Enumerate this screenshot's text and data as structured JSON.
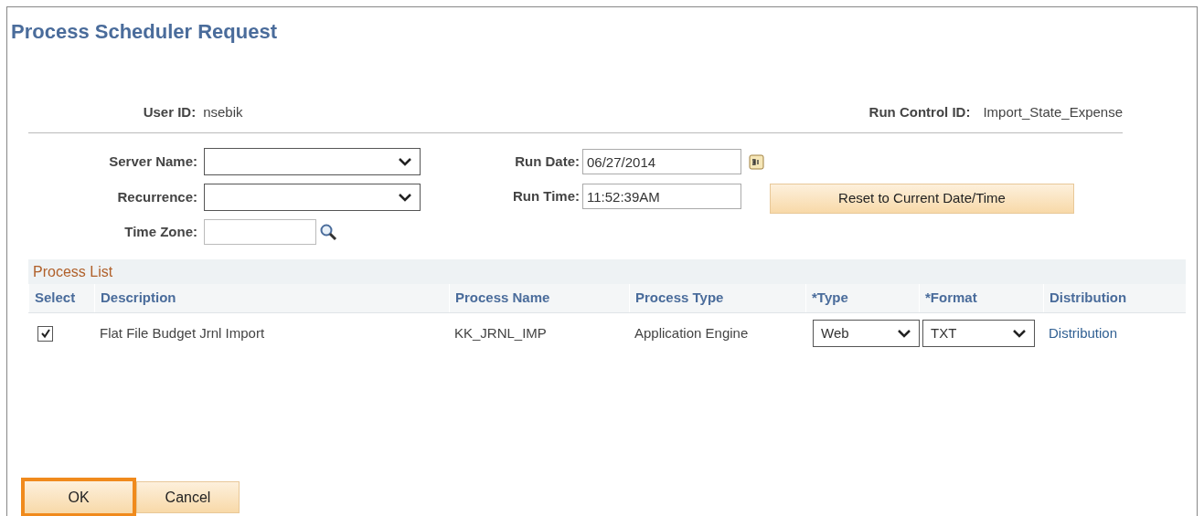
{
  "title": "Process Scheduler Request",
  "user_id": {
    "label": "User ID:",
    "value": "nsebik"
  },
  "run_control_id": {
    "label": "Run Control ID:",
    "value": "Import_State_Expense"
  },
  "server_name": {
    "label": "Server Name:"
  },
  "recurrence": {
    "label": "Recurrence:"
  },
  "time_zone": {
    "label": "Time Zone:"
  },
  "run_date": {
    "label": "Run Date:",
    "value": "06/27/2014"
  },
  "run_time": {
    "label": "Run Time:",
    "value": "11:52:39AM"
  },
  "reset_button": "Reset to Current Date/Time",
  "process_list": {
    "title": "Process List",
    "columns": [
      "Select",
      "Description",
      "Process Name",
      "Process Type",
      "*Type",
      "*Format",
      "Distribution"
    ],
    "rows": [
      {
        "selected": true,
        "description": "Flat File Budget Jrnl Import",
        "process_name": "KK_JRNL_IMP",
        "process_type": "Application Engine",
        "type": "Web",
        "format": "TXT",
        "distribution": "Distribution"
      }
    ]
  },
  "buttons": [
    {
      "label": "OK",
      "focused": true
    },
    {
      "label": "Cancel",
      "focused": false
    }
  ]
}
